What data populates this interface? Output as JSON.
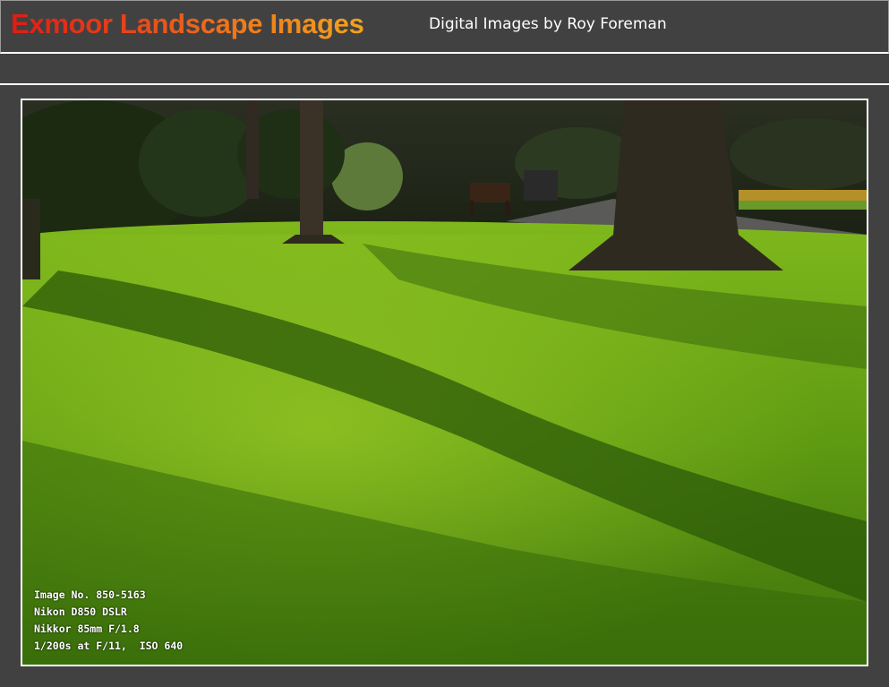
{
  "header": {
    "title": "Exmoor Landscape Images",
    "subtitle": "Digital Images by Roy Foreman"
  },
  "photo": {
    "caption_lines": [
      "Image No. 850-5163",
      "Nikon D850 DSLR",
      "Nikkor 85mm F/1.8",
      "1/200s at F/11,  ISO 640"
    ]
  }
}
